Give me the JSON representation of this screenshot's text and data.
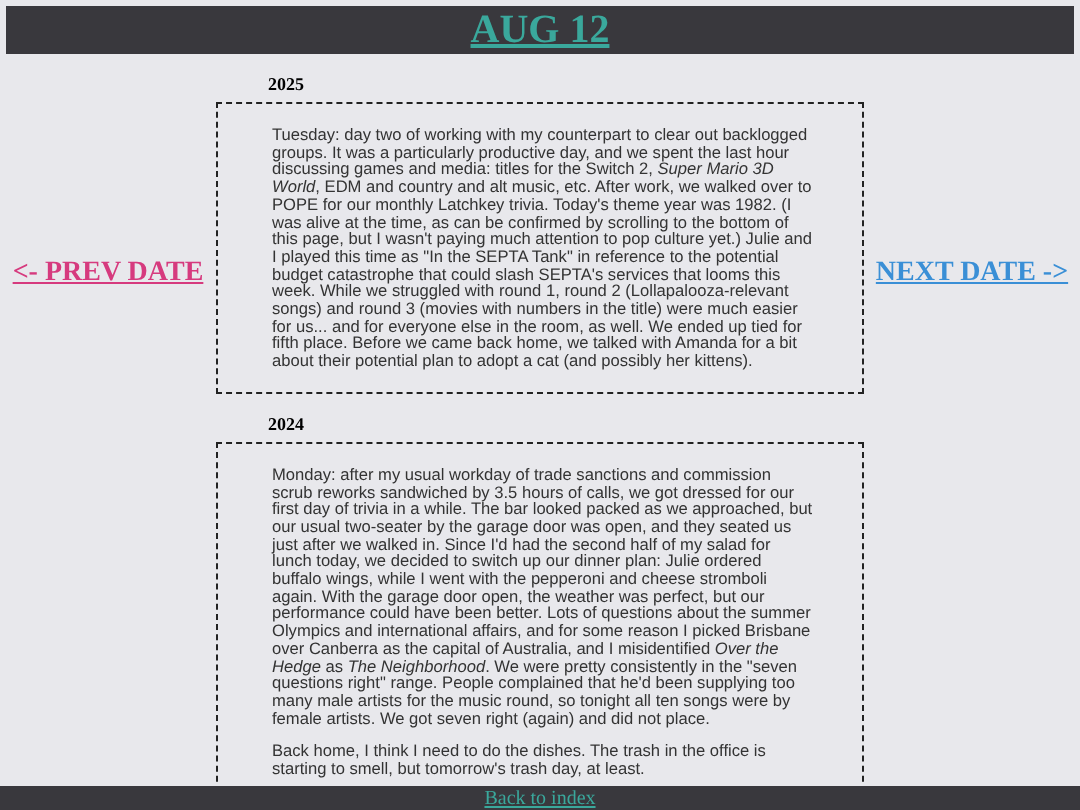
{
  "header": {
    "title": "AUG 12"
  },
  "prev_link": "<- PREV DATE",
  "next_link": "NEXT DATE ->",
  "entries": [
    {
      "year": "2025",
      "paragraphs": [
        "Tuesday: day two of working with my counterpart to clear out backlogged groups. It was a particularly productive day, and we spent the last hour discussing games and media: titles for the Switch 2, *Super Mario 3D World*, EDM and country and alt music, etc. After work, we walked over to POPE for our monthly Latchkey trivia. Today's theme year was 1982. (I was alive at the time, as can be confirmed by scrolling to the bottom of this page, but I wasn't paying much attention to pop culture yet.) Julie and I played this time as \"In the SEPTA Tank\" in reference to the potential budget catastrophe that could slash SEPTA's services that looms this week. While we struggled with round 1, round 2 (Lollapalooza-relevant songs) and round 3 (movies with numbers in the title) were much easier for us... and for everyone else in the room, as well. We ended up tied for fifth place. Before we came back home, we talked with Amanda for a bit about their potential plan to adopt a cat (and possibly her kittens)."
      ]
    },
    {
      "year": "2024",
      "paragraphs": [
        "Monday: after my usual workday of trade sanctions and commission scrub reworks sandwiched by 3.5 hours of calls, we got dressed for our first day of trivia in a while. The bar looked packed as we approached, but our usual two-seater by the garage door was open, and they seated us just after we walked in. Since I'd had the second half of my salad for lunch today, we decided to switch up our dinner plan: Julie ordered buffalo wings, while I went with the pepperoni and cheese stromboli again. With the garage door open, the weather was perfect, but our performance could have been better. Lots of questions about the summer Olympics and international affairs, and for some reason I picked Brisbane over Canberra as the capital of Australia, and I misidentified *Over the Hedge* as *The Neighborhood*. We were pretty consistently in the \"seven questions right\" range. People complained that he'd been supplying too many male artists for the music round, so tonight all ten songs were by female artists. We got seven right (again) and did not place.",
        "Back home, I think I need to do the dishes. The trash in the office is starting to smell, but tomorrow's trash day, at least."
      ]
    }
  ],
  "footer_link": "Back to index"
}
